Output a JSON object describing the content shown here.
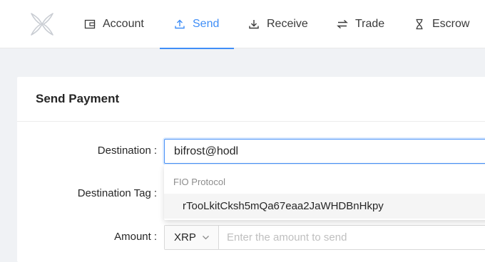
{
  "nav": {
    "items": [
      {
        "label": "Account",
        "icon": "wallet-icon"
      },
      {
        "label": "Send",
        "icon": "upload-icon"
      },
      {
        "label": "Receive",
        "icon": "download-icon"
      },
      {
        "label": "Trade",
        "icon": "swap-icon"
      },
      {
        "label": "Escrow",
        "icon": "hourglass-icon"
      }
    ],
    "active": "Send",
    "accent": "#3f8ef7"
  },
  "card": {
    "title": "Send Payment"
  },
  "form": {
    "destination_label": "Destination",
    "destination_value": "bifrost@hodl",
    "destination_tag_label": "Destination Tag",
    "amount_label": "Amount",
    "currency": "XRP",
    "amount_placeholder": "Enter the amount to send",
    "label_colon": ":"
  },
  "autocomplete": {
    "group_label": "FIO Protocol",
    "option": "rTooLkitCksh5mQa67eaa2JaWHDBnHkpy"
  }
}
